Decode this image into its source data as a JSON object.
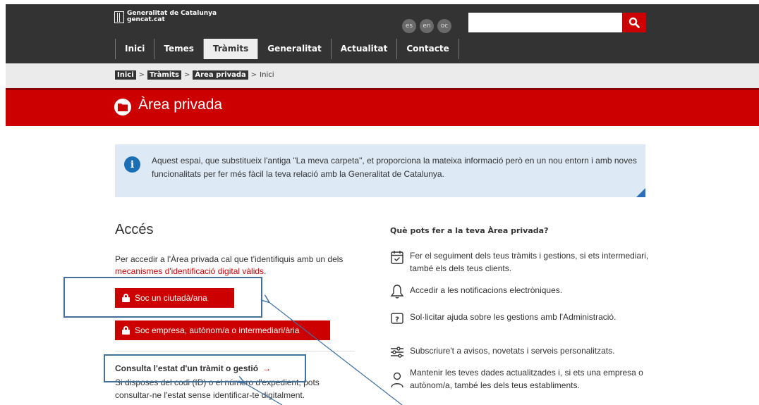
{
  "header": {
    "logo_line1": "Generalitat de Catalunya",
    "logo_line2": "gencat.cat",
    "languages": [
      "es",
      "en",
      "oc"
    ],
    "search": {
      "value": "",
      "placeholder": ""
    }
  },
  "nav": {
    "items": [
      "Inici",
      "Temes",
      "Tràmits",
      "Generalitat",
      "Actualitat",
      "Contacte"
    ],
    "active": "Tràmits"
  },
  "breadcrumb": {
    "items": [
      "Inici",
      "Tràmits",
      "Àrea privada",
      "Inici"
    ],
    "separator": ">"
  },
  "banner": {
    "title": "Àrea privada"
  },
  "info": {
    "text": "Aquest espai, que substitueix l'antiga \"La meva carpeta\", et proporciona la mateixa informació però en un nou entorn i amb noves funcionalitats per fer més fàcil la teva relació amb la Generalitat de Catalunya."
  },
  "access": {
    "title": "Accés",
    "text_before": "Per accedir a l'Àrea privada cal que t'identifiquis amb un dels ",
    "link": "mecanismes d'identificació digital vàlids",
    "text_after": ".",
    "citizen_button": "Soc un ciutadà/ana",
    "company_button": "Soc empresa, autònom/a o intermediari/ària",
    "consult_title": "Consulta l'estat d'un tràmit o gestió",
    "consult_arrow": "→",
    "consult_text": "Si disposes del codi (ID) o el número d'expedient, pots consultar-ne l'estat sense identificar-te digitalment."
  },
  "features": {
    "title": "Què pots fer a la teva Àrea privada?",
    "items": [
      {
        "icon": "calendar-check-icon",
        "text": "Fer el seguiment dels teus tràmits i gestions, si ets intermediari, també els dels teus clients."
      },
      {
        "icon": "bell-icon",
        "text": "Accedir a les notificacions electròniques."
      },
      {
        "icon": "help-icon",
        "text": "Sol·licitar ajuda sobre les gestions amb l'Administració."
      },
      {
        "icon": "sliders-icon",
        "text": "Subscriure't a avisos, novetats i serveis personalitzats."
      },
      {
        "icon": "user-icon",
        "text": "Mantenir les teves dades actualitzades i, si ets una empresa o autònom/a, també les dels teus establiments."
      }
    ]
  },
  "colors": {
    "brand_red": "#cc0000",
    "dark_bar": "#333333",
    "info_bg": "#dde9f4",
    "annotation_blue": "#41719c"
  }
}
